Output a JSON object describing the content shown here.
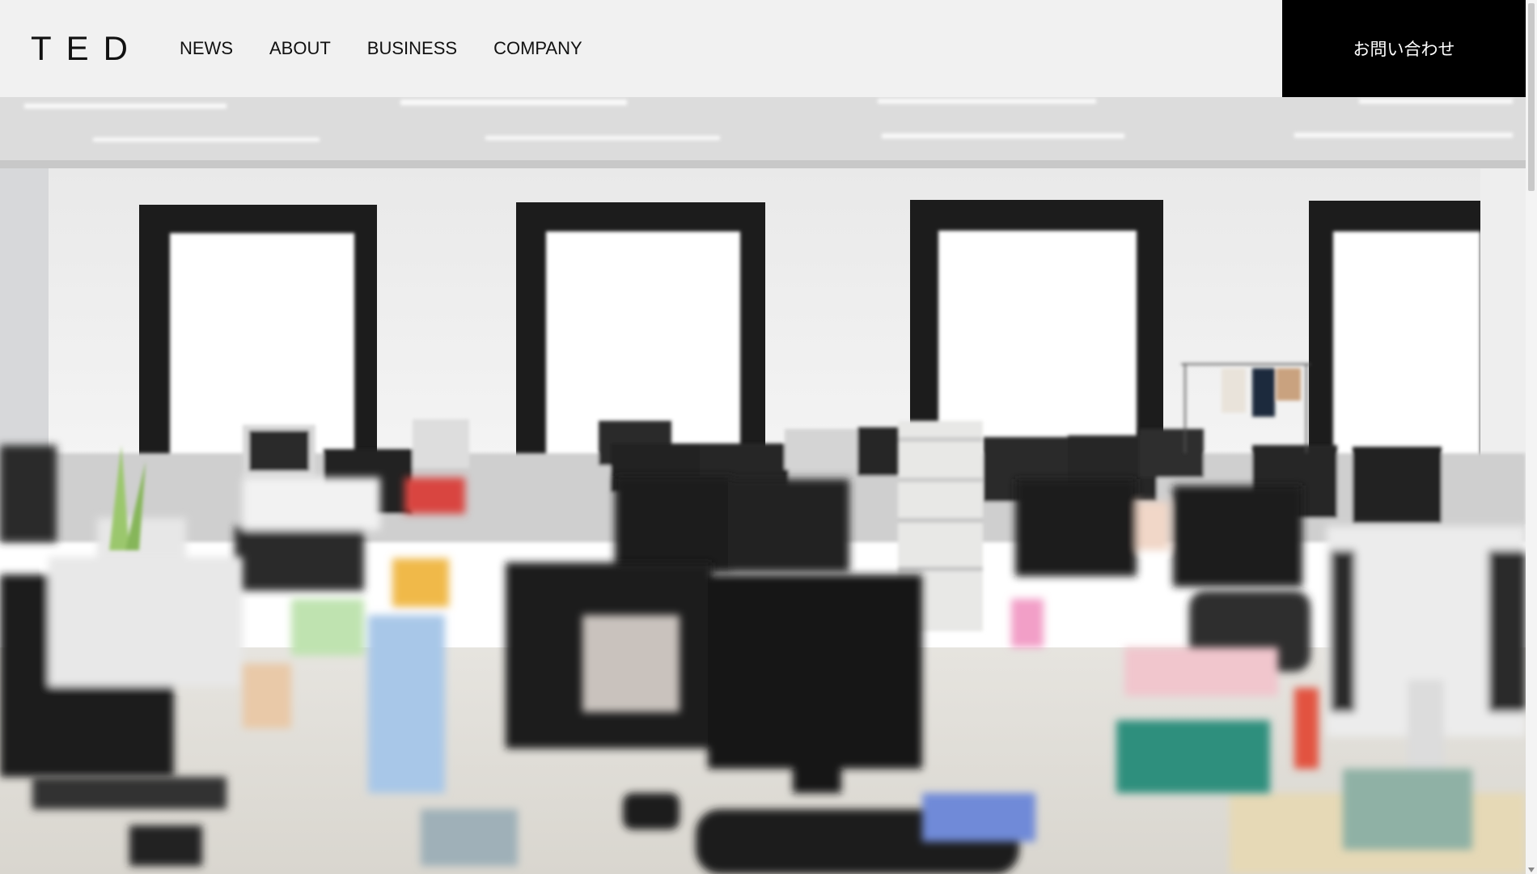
{
  "site": {
    "logo": "TED"
  },
  "nav": {
    "items": [
      "NEWS",
      "ABOUT",
      "BUSINESS",
      "COMPANY"
    ]
  },
  "contact": {
    "label": "お問い合わせ"
  },
  "hero": {
    "image_alt_subject": "office-interior-photo"
  },
  "colors": {
    "header_bg": "#f1f1f1",
    "contact_bg": "#000000",
    "contact_text": "#ffffff",
    "text": "#111111"
  }
}
